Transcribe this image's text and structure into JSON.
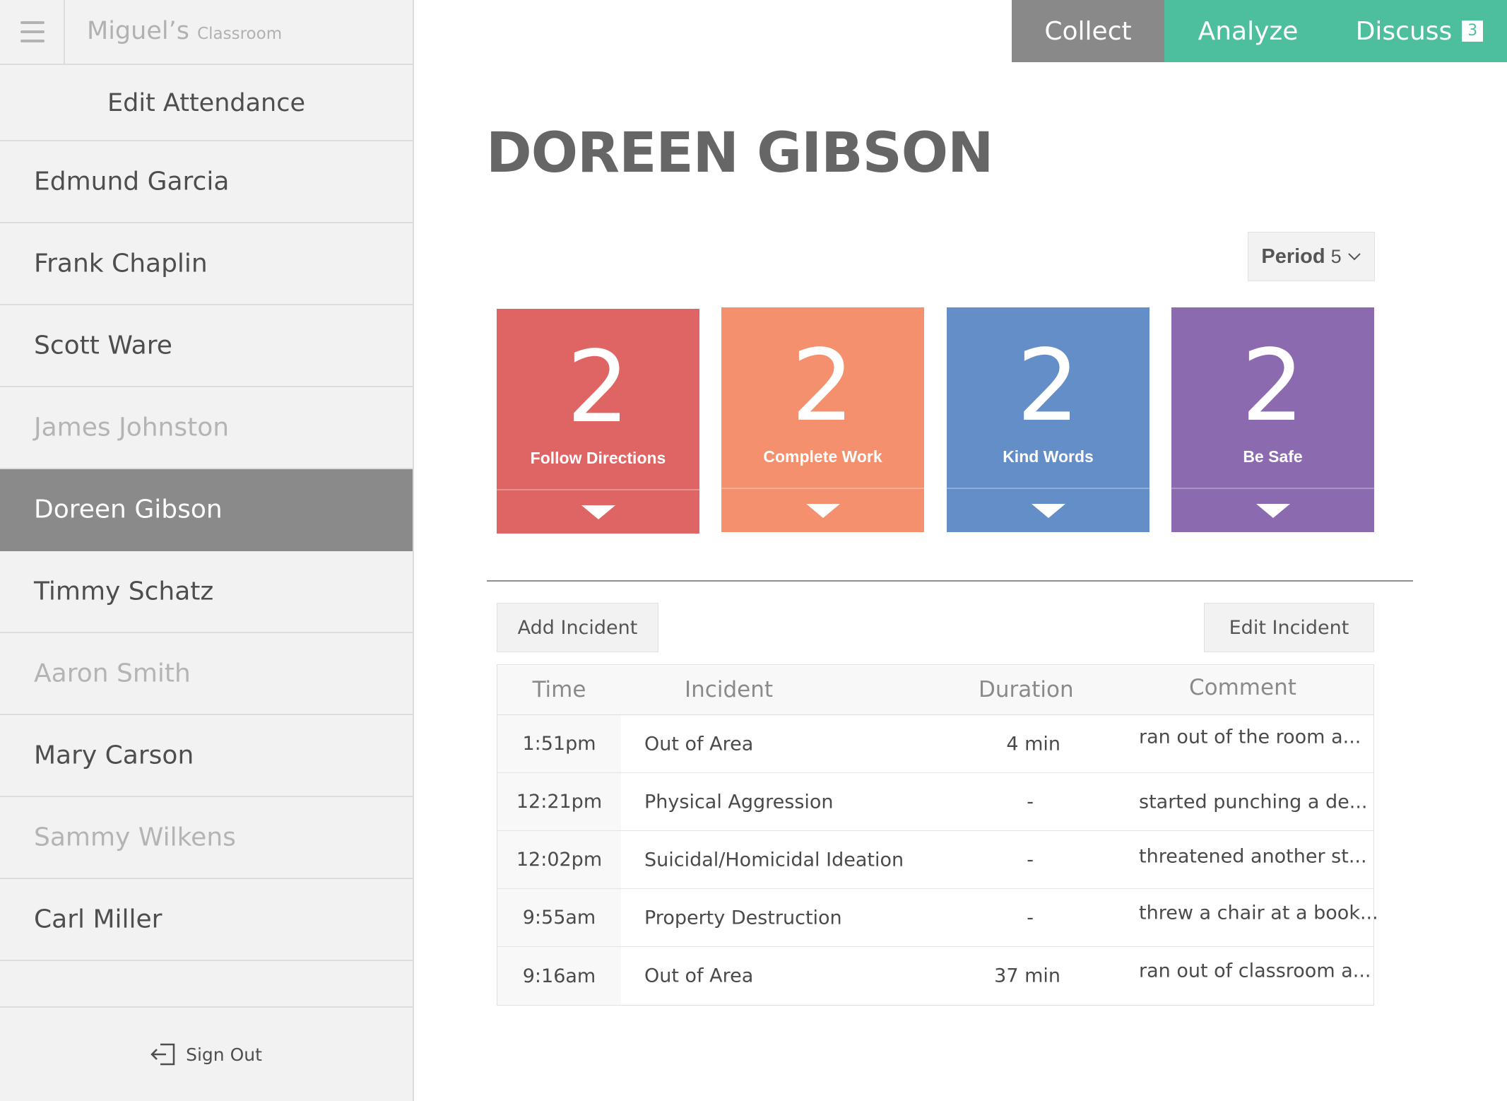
{
  "sidebar": {
    "classroom_title": "Miguel’s",
    "classroom_subtitle": "Classroom",
    "edit_attendance": "Edit Attendance",
    "students": [
      {
        "name": "Edmund Garcia",
        "status": "present"
      },
      {
        "name": "Frank Chaplin",
        "status": "present"
      },
      {
        "name": "Scott Ware",
        "status": "present"
      },
      {
        "name": "James Johnston",
        "status": "absent"
      },
      {
        "name": "Doreen Gibson",
        "status": "selected"
      },
      {
        "name": "Timmy Schatz",
        "status": "present"
      },
      {
        "name": "Aaron Smith",
        "status": "absent"
      },
      {
        "name": "Mary Carson",
        "status": "present"
      },
      {
        "name": "Sammy Wilkens",
        "status": "absent"
      },
      {
        "name": "Carl Miller",
        "status": "present"
      }
    ],
    "sign_out": "Sign Out"
  },
  "nav": {
    "collect": "Collect",
    "analyze": "Analyze",
    "discuss": "Discuss",
    "discuss_badge": "3",
    "active_tab": "Collect"
  },
  "main": {
    "student_name": "DOREEN GIBSON",
    "period_label": "Period",
    "period_value": "5",
    "cards": [
      {
        "count": "2",
        "title": "Follow Directions",
        "color": "#df6564"
      },
      {
        "count": "2",
        "title": "Complete Work",
        "color": "#f4906d"
      },
      {
        "count": "2",
        "title": "Kind Words",
        "color": "#648ec8"
      },
      {
        "count": "2",
        "title": "Be Safe",
        "color": "#8c6aaf"
      }
    ],
    "add_incident": "Add Incident",
    "edit_incident": "Edit Incident",
    "table": {
      "headers": {
        "time": "Time",
        "incident": "Incident",
        "duration": "Duration",
        "comment": "Comment"
      },
      "rows": [
        {
          "time": "1:51pm",
          "incident": "Out of Area",
          "duration": "4 min",
          "comment": "ran out of the room a..."
        },
        {
          "time": "12:21pm",
          "incident": "Physical Aggression",
          "duration": "-",
          "comment": "started punching a de..."
        },
        {
          "time": "12:02pm",
          "incident": "Suicidal/Homicidal Ideation",
          "duration": "-",
          "comment": "threatened another st..."
        },
        {
          "time": "9:55am",
          "incident": "Property Destruction",
          "duration": "-",
          "comment": "threw a chair at a book..."
        },
        {
          "time": "9:16am",
          "incident": "Out of Area",
          "duration": "37 min",
          "comment": "ran out of classroom a..."
        }
      ]
    }
  },
  "colors": {
    "accent_green": "#4dbf9f",
    "tab_gray": "#898989",
    "selected_row": "#8a8a8a"
  },
  "icons": {
    "menu": "hamburger-menu-icon",
    "sign_out": "sign-out-icon",
    "period_chevron": "chevron-down-icon",
    "card_toggle": "triangle-down-icon"
  }
}
